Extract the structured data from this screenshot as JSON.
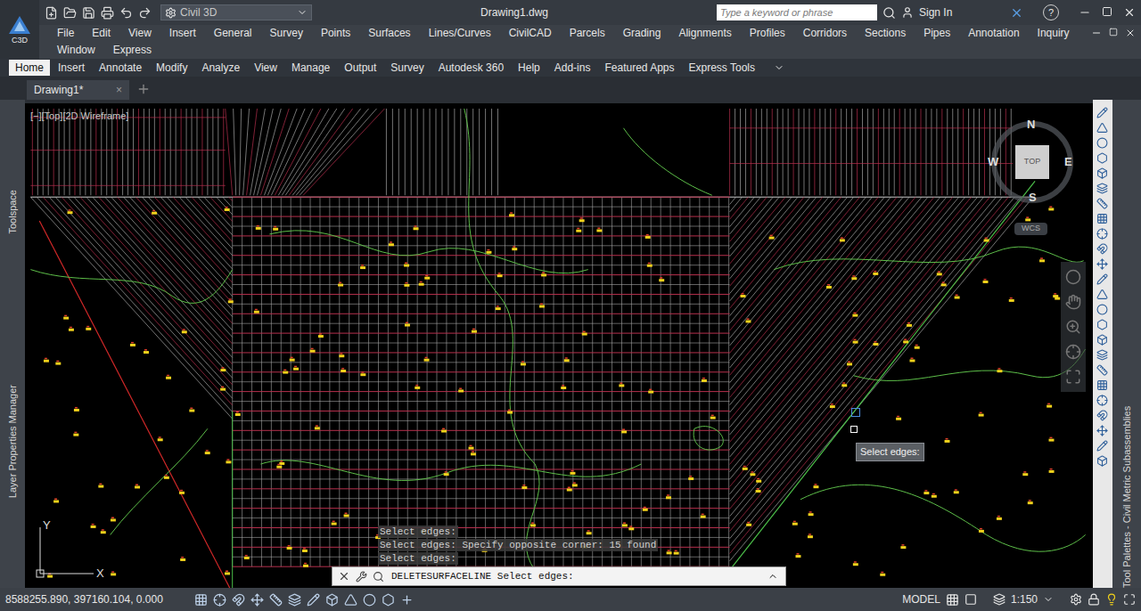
{
  "app": {
    "logo": "C3D"
  },
  "title_bar": {
    "workspace": "Civil 3D",
    "title": "Drawing1.dwg",
    "search_placeholder": "Type a keyword or phrase",
    "sign_in": "Sign In",
    "help": "?"
  },
  "menu_bar": [
    "File",
    "Edit",
    "View",
    "Insert",
    "General",
    "Survey",
    "Points",
    "Surfaces",
    "Lines/Curves",
    "CivilCAD",
    "Parcels",
    "Grading",
    "Alignments",
    "Profiles",
    "Corridors",
    "Sections",
    "Pipes",
    "Annotation",
    "Inquiry",
    "Window",
    "Express"
  ],
  "ribbon_tabs": [
    {
      "label": "Home",
      "selected": true
    },
    {
      "label": "Insert",
      "selected": false
    },
    {
      "label": "Annotate",
      "selected": false
    },
    {
      "label": "Modify",
      "selected": false
    },
    {
      "label": "Analyze",
      "selected": false
    },
    {
      "label": "View",
      "selected": false
    },
    {
      "label": "Manage",
      "selected": false
    },
    {
      "label": "Output",
      "selected": false
    },
    {
      "label": "Survey",
      "selected": false
    },
    {
      "label": "Autodesk 360",
      "selected": false
    },
    {
      "label": "Help",
      "selected": false
    },
    {
      "label": "Add-ins",
      "selected": false
    },
    {
      "label": "Featured Apps",
      "selected": false
    },
    {
      "label": "Express Tools",
      "selected": false
    }
  ],
  "file_tabs": [
    {
      "label": "Drawing1*",
      "selected": true,
      "close": "×"
    }
  ],
  "viewport": {
    "label": "[−][Top][2D Wireframe]"
  },
  "viewcube": {
    "north": "N",
    "south": "S",
    "east": "E",
    "west": "W",
    "face": "TOP",
    "ucs": "WCS"
  },
  "side_palettes": {
    "left": [
      "Toolspace",
      "Layer Properties Manager"
    ],
    "right": "Tool Palettes - Civil Metric Subassemblies"
  },
  "cursor_tooltip": "Select edges:",
  "command_history": [
    "Select edges:",
    "Select edges: Specify opposite corner: 15 found",
    "Select edges:"
  ],
  "command_line": {
    "command": "DELETESURFACELINE",
    "prompt": "Select edges:"
  },
  "axes": {
    "x": "X",
    "y": "Y"
  },
  "status_bar": {
    "coordinates": "8588255.890, 397160.104, 0.000",
    "space": "MODEL",
    "scale": "1:150"
  }
}
